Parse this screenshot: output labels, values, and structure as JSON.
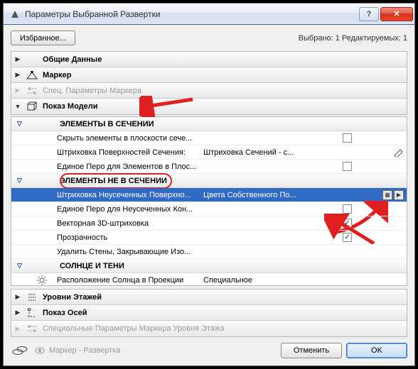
{
  "window": {
    "title": "Параметры Выбранной Развертки",
    "help_btn": "?",
    "close_btn": "✕"
  },
  "toprow": {
    "favorites_btn": "Избранное...",
    "status": "Выбрано: 1 Редактируемых: 1"
  },
  "sections": {
    "top": [
      {
        "label": "Общие Данные",
        "enabled": true,
        "icon": ""
      },
      {
        "label": "Маркер",
        "enabled": true,
        "icon": "camera"
      },
      {
        "label": "Спец. Параметры Маркера",
        "enabled": false,
        "icon": "sliders"
      },
      {
        "label": "Показ Модели",
        "enabled": true,
        "icon": "model",
        "expanded": true
      }
    ],
    "bottom": [
      {
        "label": "Уровни Этажей",
        "enabled": true,
        "icon": "levels"
      },
      {
        "label": "Показ Осей",
        "enabled": true,
        "icon": "axes"
      },
      {
        "label": "Специальные Параметры Маркера Уровня Этажа",
        "enabled": false,
        "icon": "sliders"
      }
    ]
  },
  "model_display": {
    "group1": {
      "title": "ЭЛЕМЕНТЫ В СЕЧЕНИИ",
      "items": [
        {
          "label": "Скрыть элементы в плоскости сече...",
          "value": "",
          "chk": "empty"
        },
        {
          "label": "Штриховка Поверхностей Сечения:",
          "value": "Штриховка Сечений - с...",
          "chk": null,
          "endicon": "pen"
        },
        {
          "label": "Единое Перо для Элементов в Плос...",
          "value": "",
          "chk": "empty"
        }
      ]
    },
    "group2": {
      "title": "ЭЛЕМЕНТЫ НЕ В СЕЧЕНИИ",
      "highlighted": true,
      "items": [
        {
          "label": "Штриховка Неусеченных Поверхно...",
          "value": "Цвета Собственного По...",
          "selected": true,
          "endbtns": true
        },
        {
          "label": "Единое Перо для Неусеченных Кон...",
          "value": "",
          "chk": "empty"
        },
        {
          "label": "Векторная 3D-штриховка",
          "value": "",
          "chk": "checked"
        },
        {
          "label": "Прозрачность",
          "value": "",
          "chk": "checked"
        },
        {
          "label": "Удалить Стены, Закрывающие Изо...",
          "value": "",
          "chk": null
        }
      ]
    },
    "group3": {
      "title": "СОЛНЦЕ И ТЕНИ",
      "items": [
        {
          "label": "Расположение Солнца в Проекции",
          "value": "Специальное",
          "icon": "sun"
        }
      ]
    }
  },
  "footer": {
    "filter": "Маркер - Развертка",
    "cancel": "Отменить",
    "ok": "OK"
  },
  "colors": {
    "accent_red": "#e02020",
    "select_blue": "#316ac5"
  }
}
